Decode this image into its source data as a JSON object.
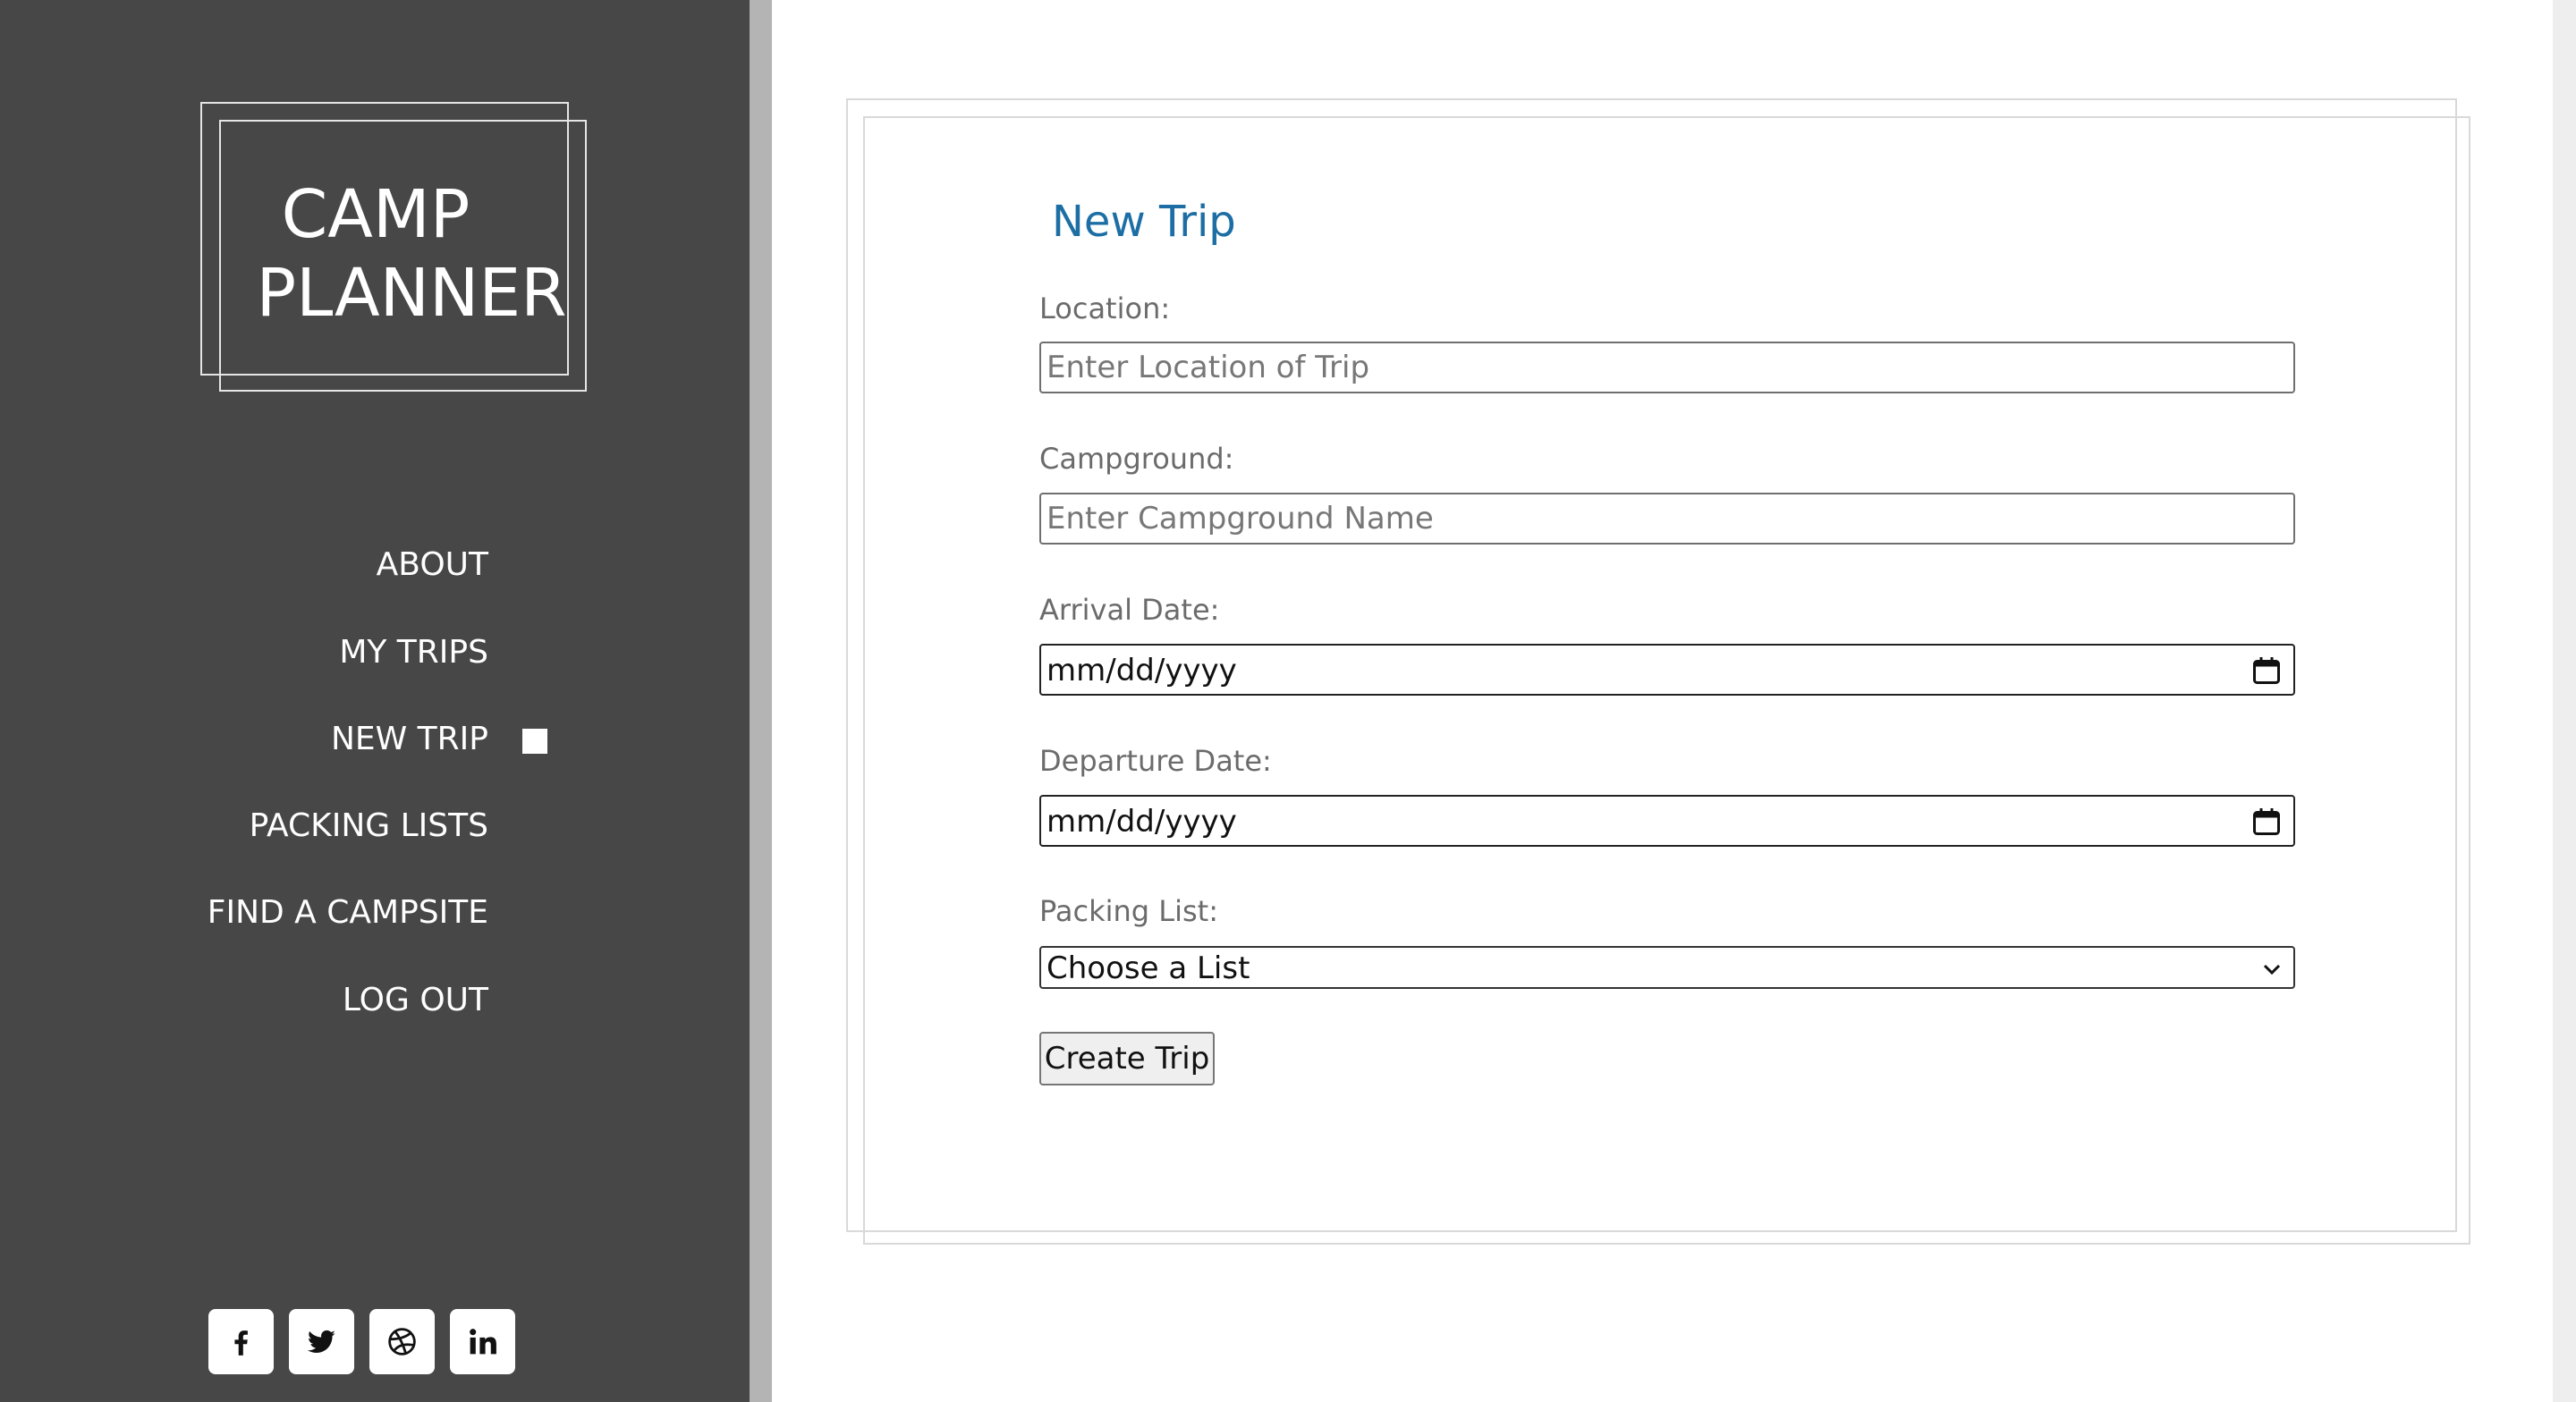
{
  "app": {
    "logo_line1": "CAMP",
    "logo_line2": "PLANNER"
  },
  "nav": {
    "items": [
      {
        "label": "ABOUT"
      },
      {
        "label": "MY TRIPS"
      },
      {
        "label": "NEW TRIP",
        "active": true
      },
      {
        "label": "PACKING LISTS"
      },
      {
        "label": "FIND A CAMPSITE"
      },
      {
        "label": "LOG OUT"
      }
    ]
  },
  "social": [
    {
      "icon": "facebook-icon"
    },
    {
      "icon": "twitter-icon"
    },
    {
      "icon": "dribbble-icon"
    },
    {
      "icon": "linkedin-icon"
    }
  ],
  "form": {
    "title": "New Trip",
    "location": {
      "label": "Location:",
      "placeholder": "Enter Location of Trip",
      "value": ""
    },
    "campground": {
      "label": "Campground:",
      "placeholder": "Enter Campground Name",
      "value": ""
    },
    "arrival": {
      "label": "Arrival Date:",
      "value": "mm/dd/yyyy"
    },
    "departure": {
      "label": "Departure Date:",
      "value": "mm/dd/yyyy"
    },
    "packing_list": {
      "label": "Packing List:",
      "selected": "Choose a List"
    },
    "submit_label": "Create Trip"
  },
  "colors": {
    "sidebar": "#474747",
    "title": "#1c6ea4",
    "label": "#6b6b6b"
  }
}
